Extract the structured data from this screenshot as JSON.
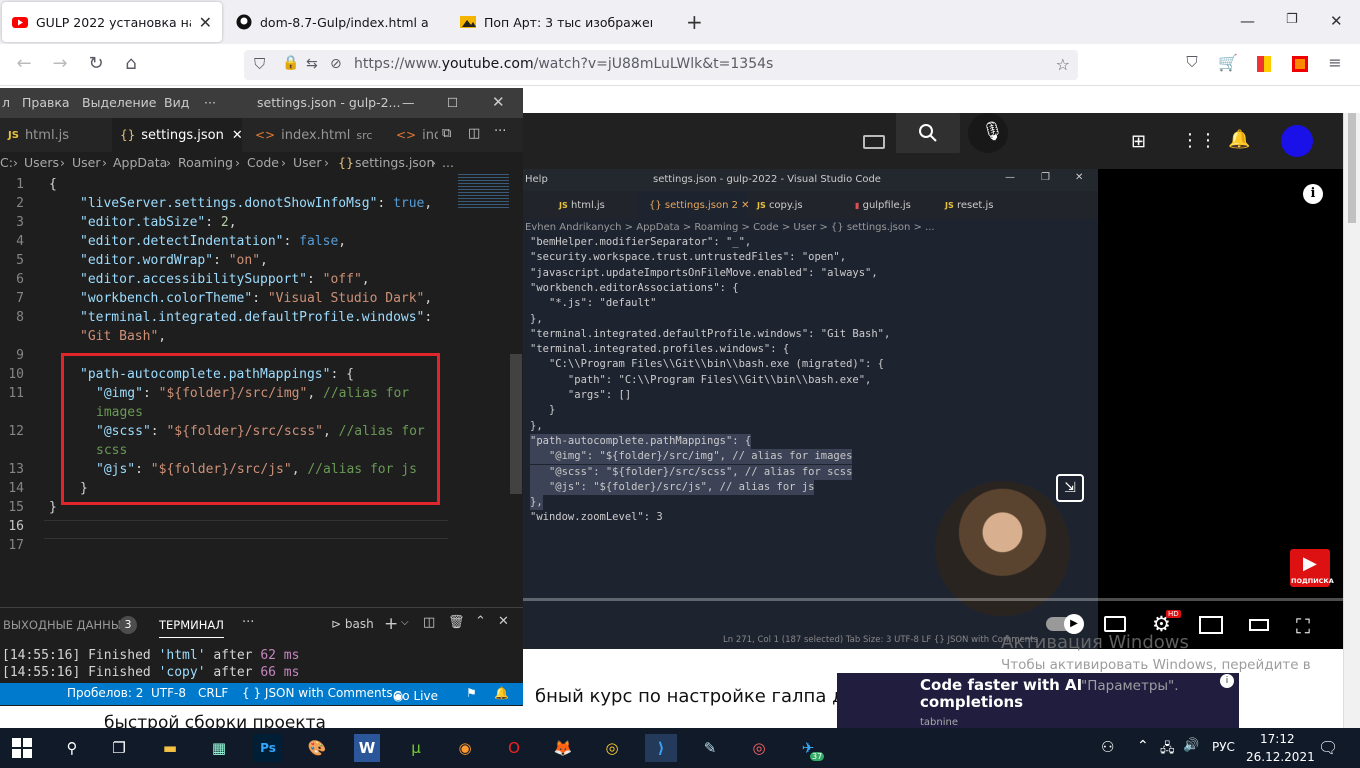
{
  "browser": {
    "tabs": [
      {
        "title": "GULP 2022 установка настрой",
        "active": true,
        "icon": "youtube-icon"
      },
      {
        "title": "dom-8.7-Gulp/index.html at ma",
        "active": false,
        "icon": "github-icon"
      },
      {
        "title": "Поп Арт: 3 тыс изображений",
        "active": false,
        "icon": "image-icon"
      }
    ],
    "url_prefix": "https://www.",
    "url_domain": "youtube.com",
    "url_rest": "/watch?v=jU88mLuLWlk&t=1354s"
  },
  "vscode": {
    "menu": [
      "л",
      "Правка",
      "Выделение",
      "Вид",
      "···"
    ],
    "window_title": "settings.json - gulp-2...",
    "tabs": [
      {
        "label": "html.js",
        "icon": "JS"
      },
      {
        "label": "settings.json",
        "icon": "{}",
        "active": true
      },
      {
        "label": "index.html",
        "icon": "<>",
        "suffix": "src"
      },
      {
        "label": "ind",
        "icon": "<>"
      }
    ],
    "breadcrumb": [
      "C:",
      "Users",
      "User",
      "AppData",
      "Roaming",
      "Code",
      "User",
      "settings.json",
      "..."
    ],
    "line_numbers": [
      "1",
      "2",
      "3",
      "4",
      "5",
      "6",
      "7",
      "8",
      "",
      "9",
      "10",
      "11",
      "",
      "12",
      "",
      "13",
      "14",
      "15",
      "16",
      "17"
    ],
    "code": {
      "l1": "{",
      "l2k": "\"liveServer.settings.donotShowInfoMsg\"",
      "l2v": "true",
      "l3k": "\"editor.tabSize\"",
      "l3v": "2",
      "l4k": "\"editor.detectIndentation\"",
      "l4v": "false",
      "l5k": "\"editor.wordWrap\"",
      "l5v": "\"on\"",
      "l6k": "\"editor.accessibilitySupport\"",
      "l6v": "\"off\"",
      "l7k": "\"workbench.colorTheme\"",
      "l7v": "\"Visual Studio Dark\"",
      "l8k": "\"terminal.integrated.defaultProfile.windows\"",
      "l8v": "\"Git Bash\"",
      "l10k": "\"path-autocomplete.pathMappings\"",
      "l11k": "\"@img\"",
      "l11v": "\"${folder}/src/img\"",
      "l11c": "//alias for",
      "l11c2": "images",
      "l12k": "\"@scss\"",
      "l12v": "\"${folder}/src/scss\"",
      "l12c": "//alias for",
      "l12c2": "scss",
      "l13k": "\"@js\"",
      "l13v": "\"${folder}/src/js\"",
      "l13c": "//alias for js",
      "l14": "}",
      "l15": "}"
    },
    "panel": {
      "output_tab": "ВЫХОДНЫЕ ДАННЫЕ",
      "output_count": "3",
      "terminal_tab": "ТЕРМИНАЛ",
      "more": "···",
      "shell": "bash",
      "lines": [
        {
          "time": "[14:55:16]",
          "text": "Finished ",
          "task": "'html'",
          "after": " after ",
          "ms": "62 ms"
        },
        {
          "time": "[14:55:16]",
          "text": "Finished ",
          "task": "'copy'",
          "after": " after ",
          "ms": "66 ms"
        }
      ]
    },
    "status": {
      "spaces": "Пробелов: 2",
      "encoding": "UTF-8",
      "eol": "CRLF",
      "language": "{ } JSON with Comments",
      "golive": "Go Live"
    }
  },
  "video": {
    "vscode_title": "settings.json - gulp-2022 - Visual Studio Code",
    "help": "Help",
    "tabs": [
      "html.js",
      "settings.json 2",
      "copy.js",
      "gulpfile.js",
      "reset.js"
    ],
    "crumbs": "Evhen Andrikanych > AppData > Roaming > Code > User > {} settings.json > ...",
    "code_lines": [
      "\"bemHelper.modifierSeparator\": \"_\",",
      "\"security.workspace.trust.untrustedFiles\": \"open\",",
      "\"javascript.updateImportsOnFileMove.enabled\": \"always\",",
      "\"workbench.editorAssociations\": {",
      "   \"*.js\": \"default\"",
      "},",
      "\"terminal.integrated.defaultProfile.windows\": \"Git Bash\",",
      "\"terminal.integrated.profiles.windows\": {",
      "   \"C:\\\\Program Files\\\\Git\\\\bin\\\\bash.exe (migrated)\": {",
      "      \"path\": \"C:\\\\Program Files\\\\Git\\\\bin\\\\bash.exe\",",
      "      \"args\": []",
      "   }",
      "},",
      "\"path-autocomplete.pathMappings\": {",
      "   \"@img\": \"${folder}/src/img\", // alias for images",
      "   \"@scss\": \"${folder}/src/scss\", // alias for scss",
      "   \"@js\": \"${folder}/src/js\", // alias for js",
      "},",
      "\"window.zoomLevel\": 3"
    ],
    "status_line": "Ln 271, Col 1 (187 selected)   Tab Size: 3   UTF-8   LF   {} JSON with Comments",
    "subscribe": "ПОДПИСКА",
    "hd": "HD"
  },
  "page": {
    "title_line1": "бный курс по настройке галпа для",
    "title_line2": "быстрой сборки проекта",
    "ad_title": "Code faster with AI completions",
    "ad_brand": "tabnine",
    "activation_title": "Активация Windows",
    "activation_text": "Чтобы активировать Windows, перейдите в",
    "activation_text2": "\"Параметры\"."
  },
  "taskbar": {
    "lang": "РУС",
    "time": "17:12",
    "date": "26.12.2021",
    "telegram_badge": "37"
  }
}
